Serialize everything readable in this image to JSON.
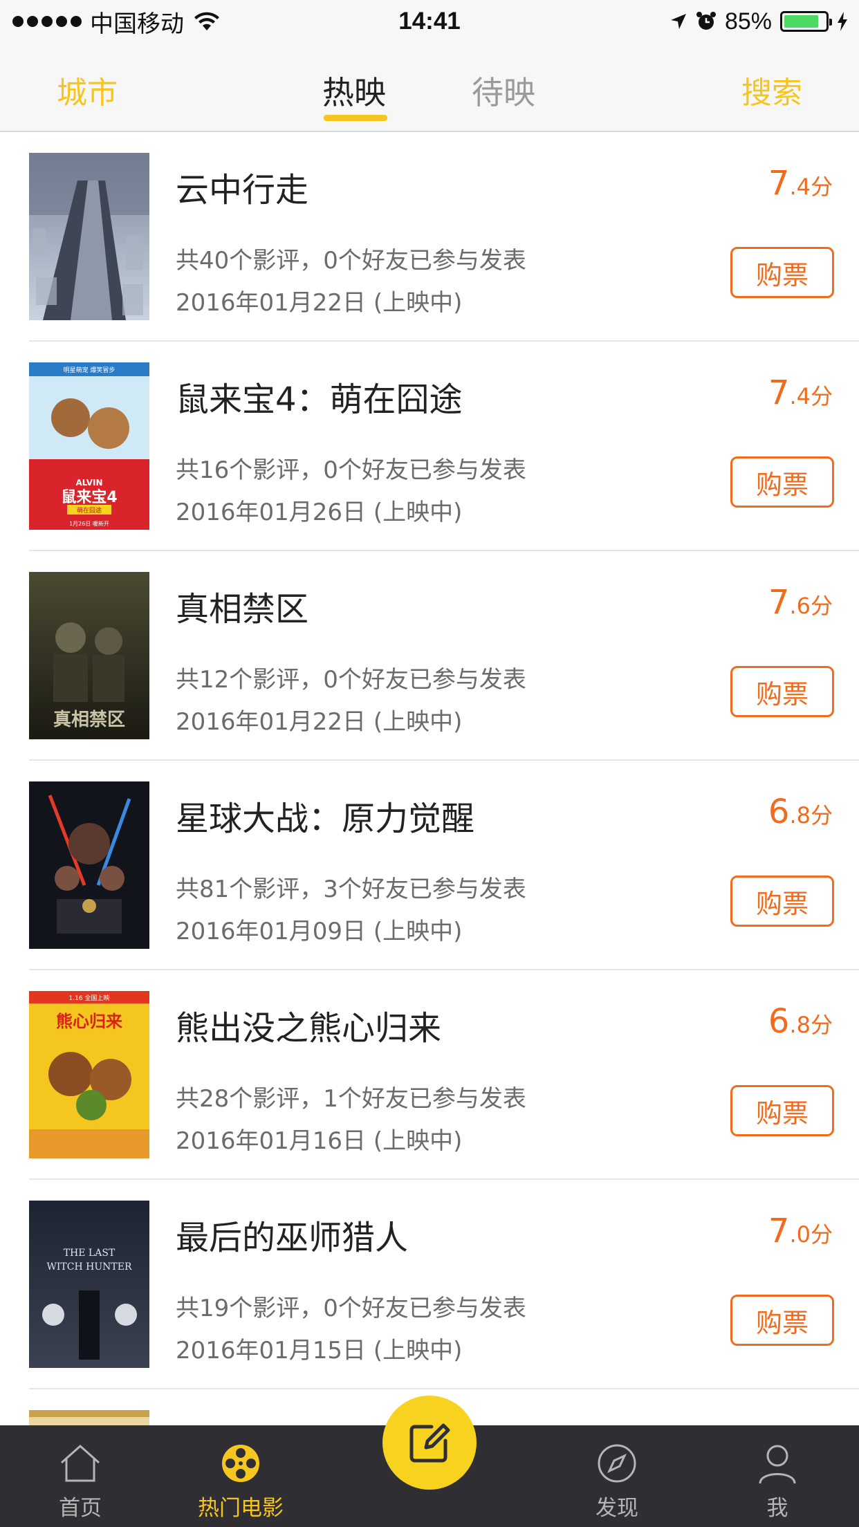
{
  "status_bar": {
    "carrier": "中国移动",
    "time": "14:41",
    "battery": "85%",
    "battery_level": 0.85
  },
  "nav": {
    "city": "城市",
    "tabs": [
      "热映",
      "待映"
    ],
    "search": "搜索",
    "accent_color": "#f7c51f"
  },
  "movies": [
    {
      "title": "云中行走",
      "score_int": "7",
      "score_dec": ".4分",
      "reviews": "共40个影评，0个好友已参与发表",
      "date": "2016年01月22日 (上映中)",
      "buy": "购票"
    },
    {
      "title": "鼠来宝4：萌在囧途",
      "score_int": "7",
      "score_dec": ".4分",
      "reviews": "共16个影评，0个好友已参与发表",
      "date": "2016年01月26日 (上映中)",
      "buy": "购票",
      "poster_text": [
        "明星萌宠 爆笑冒步",
        "ALVIN",
        "鼠来宝4",
        "萌在囧途",
        "1月26日 暖新开"
      ]
    },
    {
      "title": "真相禁区",
      "score_int": "7",
      "score_dec": ".6分",
      "reviews": "共12个影评，0个好友已参与发表",
      "date": "2016年01月22日 (上映中)",
      "buy": "购票",
      "poster_text": [
        "真相禁区"
      ]
    },
    {
      "title": "星球大战：原力觉醒",
      "score_int": "6",
      "score_dec": ".8分",
      "reviews": "共81个影评，3个好友已参与发表",
      "date": "2016年01月09日 (上映中)",
      "buy": "购票"
    },
    {
      "title": "熊出没之熊心归来",
      "score_int": "6",
      "score_dec": ".8分",
      "reviews": "共28个影评，1个好友已参与发表",
      "date": "2016年01月16日 (上映中)",
      "buy": "购票",
      "poster_text": [
        "熊心归来",
        "1.16 全国上映"
      ]
    },
    {
      "title": "最后的巫师猎人",
      "score_int": "7",
      "score_dec": ".0分",
      "reviews": "共19个影评，0个好友已参与发表",
      "date": "2016年01月15日 (上映中)",
      "buy": "购票",
      "poster_text": [
        "THE LAST",
        "WITCH HUNTER"
      ]
    }
  ],
  "tab_bar": {
    "items": [
      {
        "label": "首页",
        "icon": "home-icon"
      },
      {
        "label": "热门电影",
        "icon": "film-reel-icon"
      },
      {
        "label": "",
        "icon": "compose-icon"
      },
      {
        "label": "发现",
        "icon": "compass-icon"
      },
      {
        "label": "我",
        "icon": "person-icon"
      }
    ],
    "active_color": "#f7c51f",
    "compose_color": "#f7d21f"
  }
}
